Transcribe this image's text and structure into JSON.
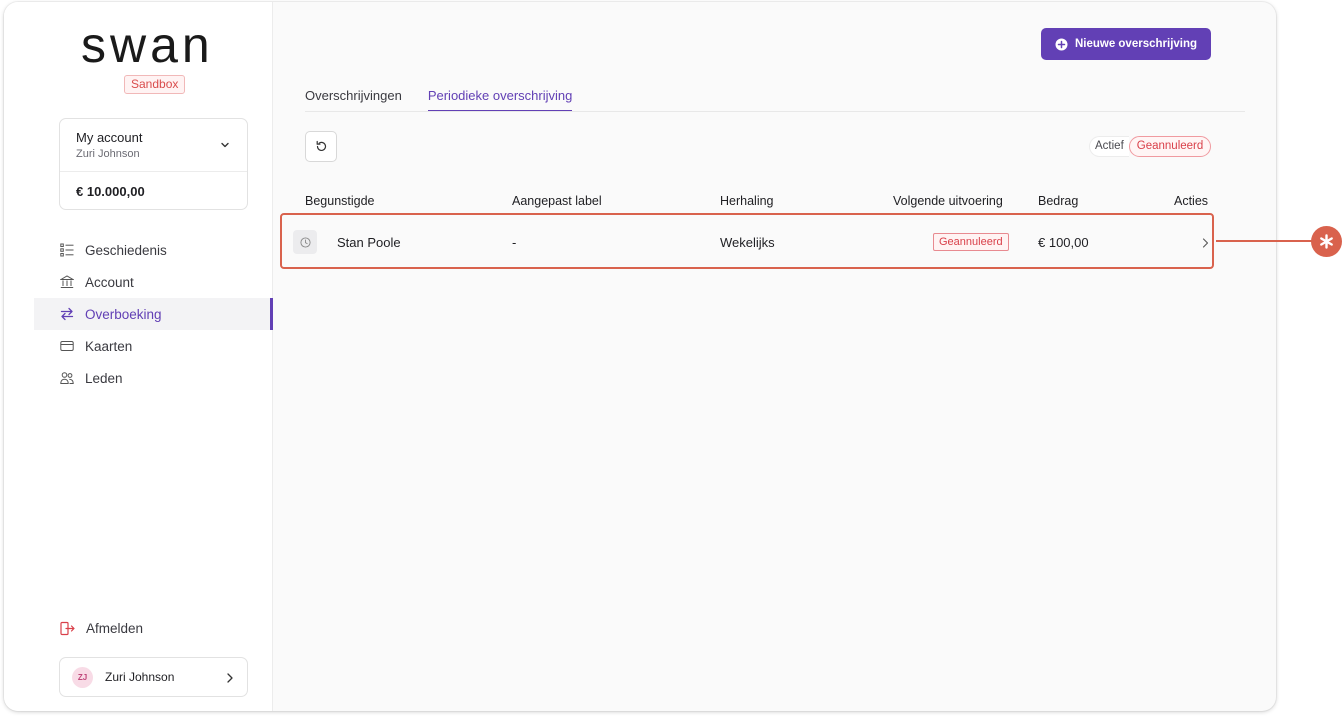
{
  "brand": {
    "logo_text": "swan",
    "env_badge": "Sandbox"
  },
  "account": {
    "name": "My account",
    "holder": "Zuri Johnson",
    "balance": "€ 10.000,00"
  },
  "nav": {
    "items": [
      {
        "label": "Geschiedenis",
        "icon": "list-icon",
        "active": false
      },
      {
        "label": "Account",
        "icon": "bank-icon",
        "active": false
      },
      {
        "label": "Overboeking",
        "icon": "arrows-swap-icon",
        "active": true
      },
      {
        "label": "Kaarten",
        "icon": "card-icon",
        "active": false
      },
      {
        "label": "Leden",
        "icon": "people-icon",
        "active": false
      }
    ],
    "logout": "Afmelden"
  },
  "user": {
    "initials": "ZJ",
    "name": "Zuri Johnson"
  },
  "toolbar": {
    "new_transfer_label": "Nieuwe overschrijving"
  },
  "tabs": [
    {
      "label": "Overschrijvingen",
      "active": false
    },
    {
      "label": "Periodieke overschrijving",
      "active": true
    }
  ],
  "filters": {
    "active_label": "Actief",
    "cancelled_label": "Geannuleerd"
  },
  "table": {
    "columns": [
      "Begunstigde",
      "Aangepast label",
      "Herhaling",
      "Volgende uitvoering",
      "Bedrag",
      "Acties"
    ],
    "rows": [
      {
        "beneficiary": "Stan Poole",
        "custom_label": "-",
        "recurrence": "Wekelijks",
        "next_execution": "Geannuleerd",
        "amount": "€ 100,00"
      }
    ]
  },
  "colors": {
    "accent": "#6240b5",
    "danger": "#d9404a",
    "callout": "#d9624d"
  }
}
